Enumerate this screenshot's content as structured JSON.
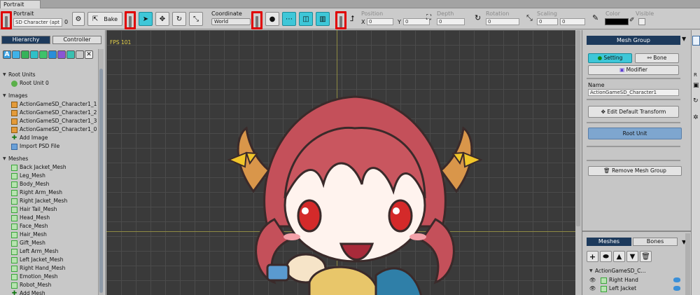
{
  "window": {
    "tab_label": "Portrait"
  },
  "toolbar": {
    "portrait_label": "Portrait",
    "portrait_value": "SD Character (apt",
    "portrait_suffix": "0",
    "bake_label": "Bake",
    "coordinate_label": "Coordinate",
    "coordinate_value": "World",
    "position_label": "Position",
    "x_label": "X",
    "x_value": "0",
    "y_label": "Y",
    "y_value": "0",
    "depth_label": "Depth",
    "depth_value": "0",
    "rotation_label": "Rotation",
    "rotation_value": "0",
    "scaling_label": "Scaling",
    "scale_x_value": "0",
    "scale_y_value": "0",
    "color_label": "Color",
    "visible_label": "Visible"
  },
  "left": {
    "tab_hierarchy": "Hierarchy",
    "tab_controller": "Controller",
    "filter_icons": [
      "A",
      "■",
      "■",
      "■",
      "■",
      "■",
      "■",
      "■",
      "■",
      "■",
      "✕"
    ],
    "sections": [
      {
        "title": "Root Units",
        "items": [
          "Root Unit 0"
        ]
      },
      {
        "title": "Images",
        "items": [
          "ActionGameSD_Character1_1",
          "ActionGameSD_Character1_2",
          "ActionGameSD_Character1_3",
          "ActionGameSD_Character1_0",
          "Add Image",
          "Import PSD File"
        ]
      },
      {
        "title": "Meshes",
        "items": [
          "Back Jacket_Mesh",
          "Leg_Mesh",
          "Body_Mesh",
          "Right Arm_Mesh",
          "Right Jacket_Mesh",
          "Hair Tail_Mesh",
          "Head_Mesh",
          "Face_Mesh",
          "Hair_Mesh",
          "Gift_Mesh",
          "Left Arm_Mesh",
          "Left Jacket_Mesh",
          "Right Hand_Mesh",
          "Emotion_Mesh",
          "Robot_Mesh",
          "Add Mesh"
        ]
      }
    ]
  },
  "viewport": {
    "fps": "FPS 101"
  },
  "right": {
    "header": "Mesh Group",
    "tab_setting": "Setting",
    "tab_bone": "Bone",
    "modifier": "Modifier",
    "name_label": "Name",
    "name_value": "ActionGameSD_Character1",
    "edit_default_transform": "Edit Default Transform",
    "root_unit": "Root Unit",
    "remove_mesh_group": "Remove Mesh Group",
    "tab_meshes": "Meshes",
    "tab_bones": "Bones",
    "tree_root": "ActionGameSD_C...",
    "tree_items": [
      "Right Hand",
      "Left Jacket"
    ]
  },
  "colors": {
    "accent": "#3ec7d8",
    "selected_tab": "#1d3a5c",
    "root_unit": "#7ea6cf",
    "highlight": "#e00000"
  }
}
